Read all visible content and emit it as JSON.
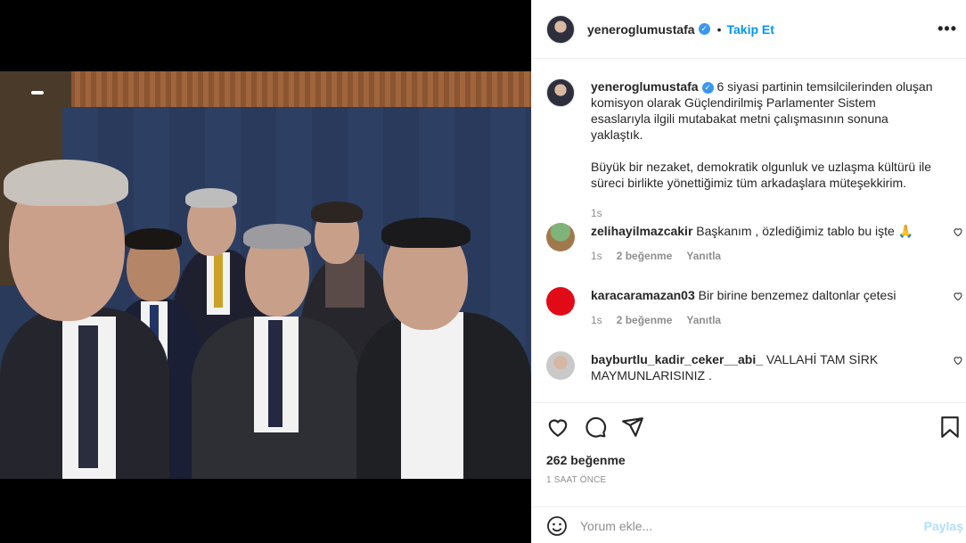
{
  "header": {
    "username": "yeneroglumustafa",
    "separator": "•",
    "follow_label": "Takip Et",
    "more_label": "•••"
  },
  "caption": {
    "username": "yeneroglumustafa",
    "paragraph1": "6 siyasi partinin temsilcilerinden oluşan komisyon olarak Güçlendirilmiş Parlamenter Sistem esaslarıyla ilgili mutabakat metni çalışmasının sonuna yaklaştık.",
    "paragraph2": "Büyük bir nezaket, demokratik olgunluk ve uzlaşma kültürü ile süreci birlikte yönettiğimiz tüm arkadaşlara müteşekkirim.",
    "time": "1s"
  },
  "comments": [
    {
      "username": "zelihayilmazcakir",
      "text": "Başkanım , özlediğimiz tablo bu işte 🙏",
      "time": "1s",
      "likes": "2 beğenme",
      "reply": "Yanıtla"
    },
    {
      "username": "karacaramazan03",
      "text": "Bir birine benzemez daltonlar çetesi",
      "time": "1s",
      "likes": "2 beğenme",
      "reply": "Yanıtla"
    },
    {
      "username": "bayburtlu_kadir_ceker__abi_",
      "text": "VALLAHİ TAM SİRK MAYMUNLARISINIZ .",
      "time": "",
      "likes": "",
      "reply": ""
    }
  ],
  "actions": {
    "likes_count": "262 beğenme",
    "post_time": "1 SAAT ÖNCE"
  },
  "comment_box": {
    "placeholder": "Yorum ekle...",
    "share_label": "Paylaş"
  },
  "colors": {
    "accent": "#0095f6",
    "share_disabled": "#b2dffc",
    "muted": "#8e8e8e"
  }
}
